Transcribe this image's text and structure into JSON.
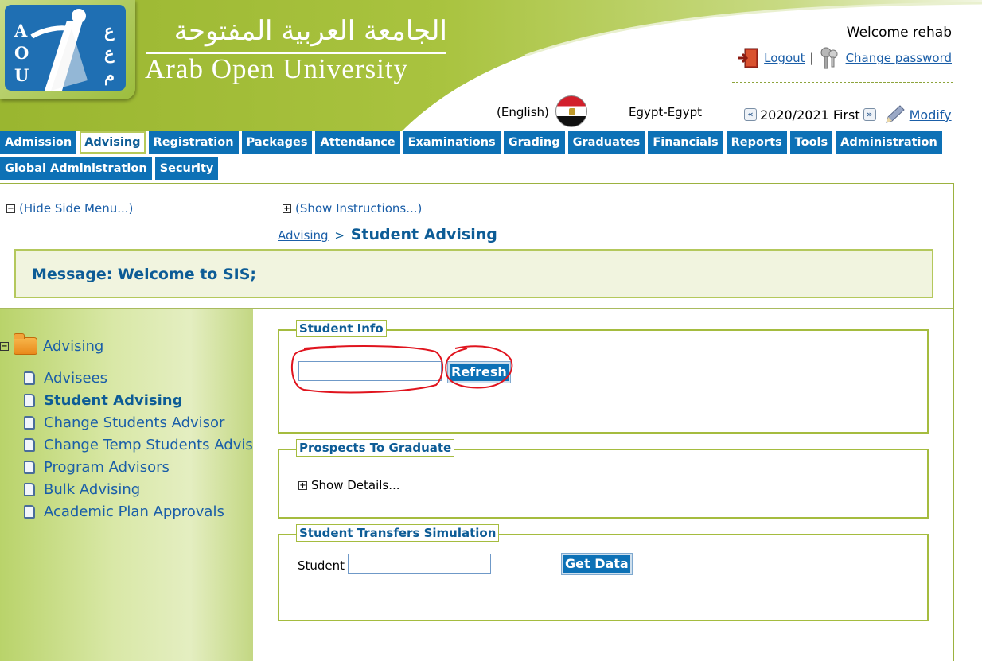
{
  "header": {
    "university_arabic": "الجامعة العربية المفتوحة",
    "university_english": "Arab Open University",
    "logo_letters_left": [
      "A",
      "O",
      "U"
    ],
    "logo_letters_right": [
      "ع",
      "ع",
      "م"
    ],
    "welcome": "Welcome rehab",
    "logout": "Logout",
    "separator": "|",
    "change_password": "Change password",
    "language": "(English)",
    "country": "Egypt-Egypt",
    "term": "2020/2021 First",
    "modify": "Modify",
    "prev_term_icon": "«",
    "next_term_icon": "»"
  },
  "menu": {
    "row1": [
      "Admission",
      "Advising",
      "Registration",
      "Packages",
      "Attendance",
      "Examinations",
      "Grading",
      "Graduates",
      "Financials",
      "Reports",
      "Tools",
      "Administration"
    ],
    "row2": [
      "Global Administration",
      "Security"
    ],
    "active": "Advising"
  },
  "page": {
    "hide_side_menu": "(Hide Side Menu...)",
    "show_instructions": "(Show Instructions...)",
    "breadcrumb_parent": "Advising",
    "breadcrumb_sep": ">",
    "breadcrumb_current": "Student Advising",
    "message": "Message: Welcome to SIS;"
  },
  "side_menu": {
    "root": "Advising",
    "items": [
      "Advisees",
      "Student Advising",
      "Change Students Advisor",
      "Change Temp Students Advisor",
      "Program Advisors",
      "Bulk Advising",
      "Academic Plan Approvals"
    ],
    "current": "Student Advising"
  },
  "student_info": {
    "legend": "Student Info",
    "input_value": "",
    "refresh_button": "Refresh"
  },
  "prospects": {
    "legend": "Prospects To Graduate",
    "show_details": "Show Details..."
  },
  "transfers": {
    "legend": "Student Transfers Simulation",
    "student_label": "Student",
    "input_value": "",
    "get_data_button": "Get Data"
  },
  "colors": {
    "header_green": "#9cba34",
    "menu_blue": "#0d71b6",
    "link_blue": "#1a5ea8",
    "annotation_red": "#e0141e"
  }
}
